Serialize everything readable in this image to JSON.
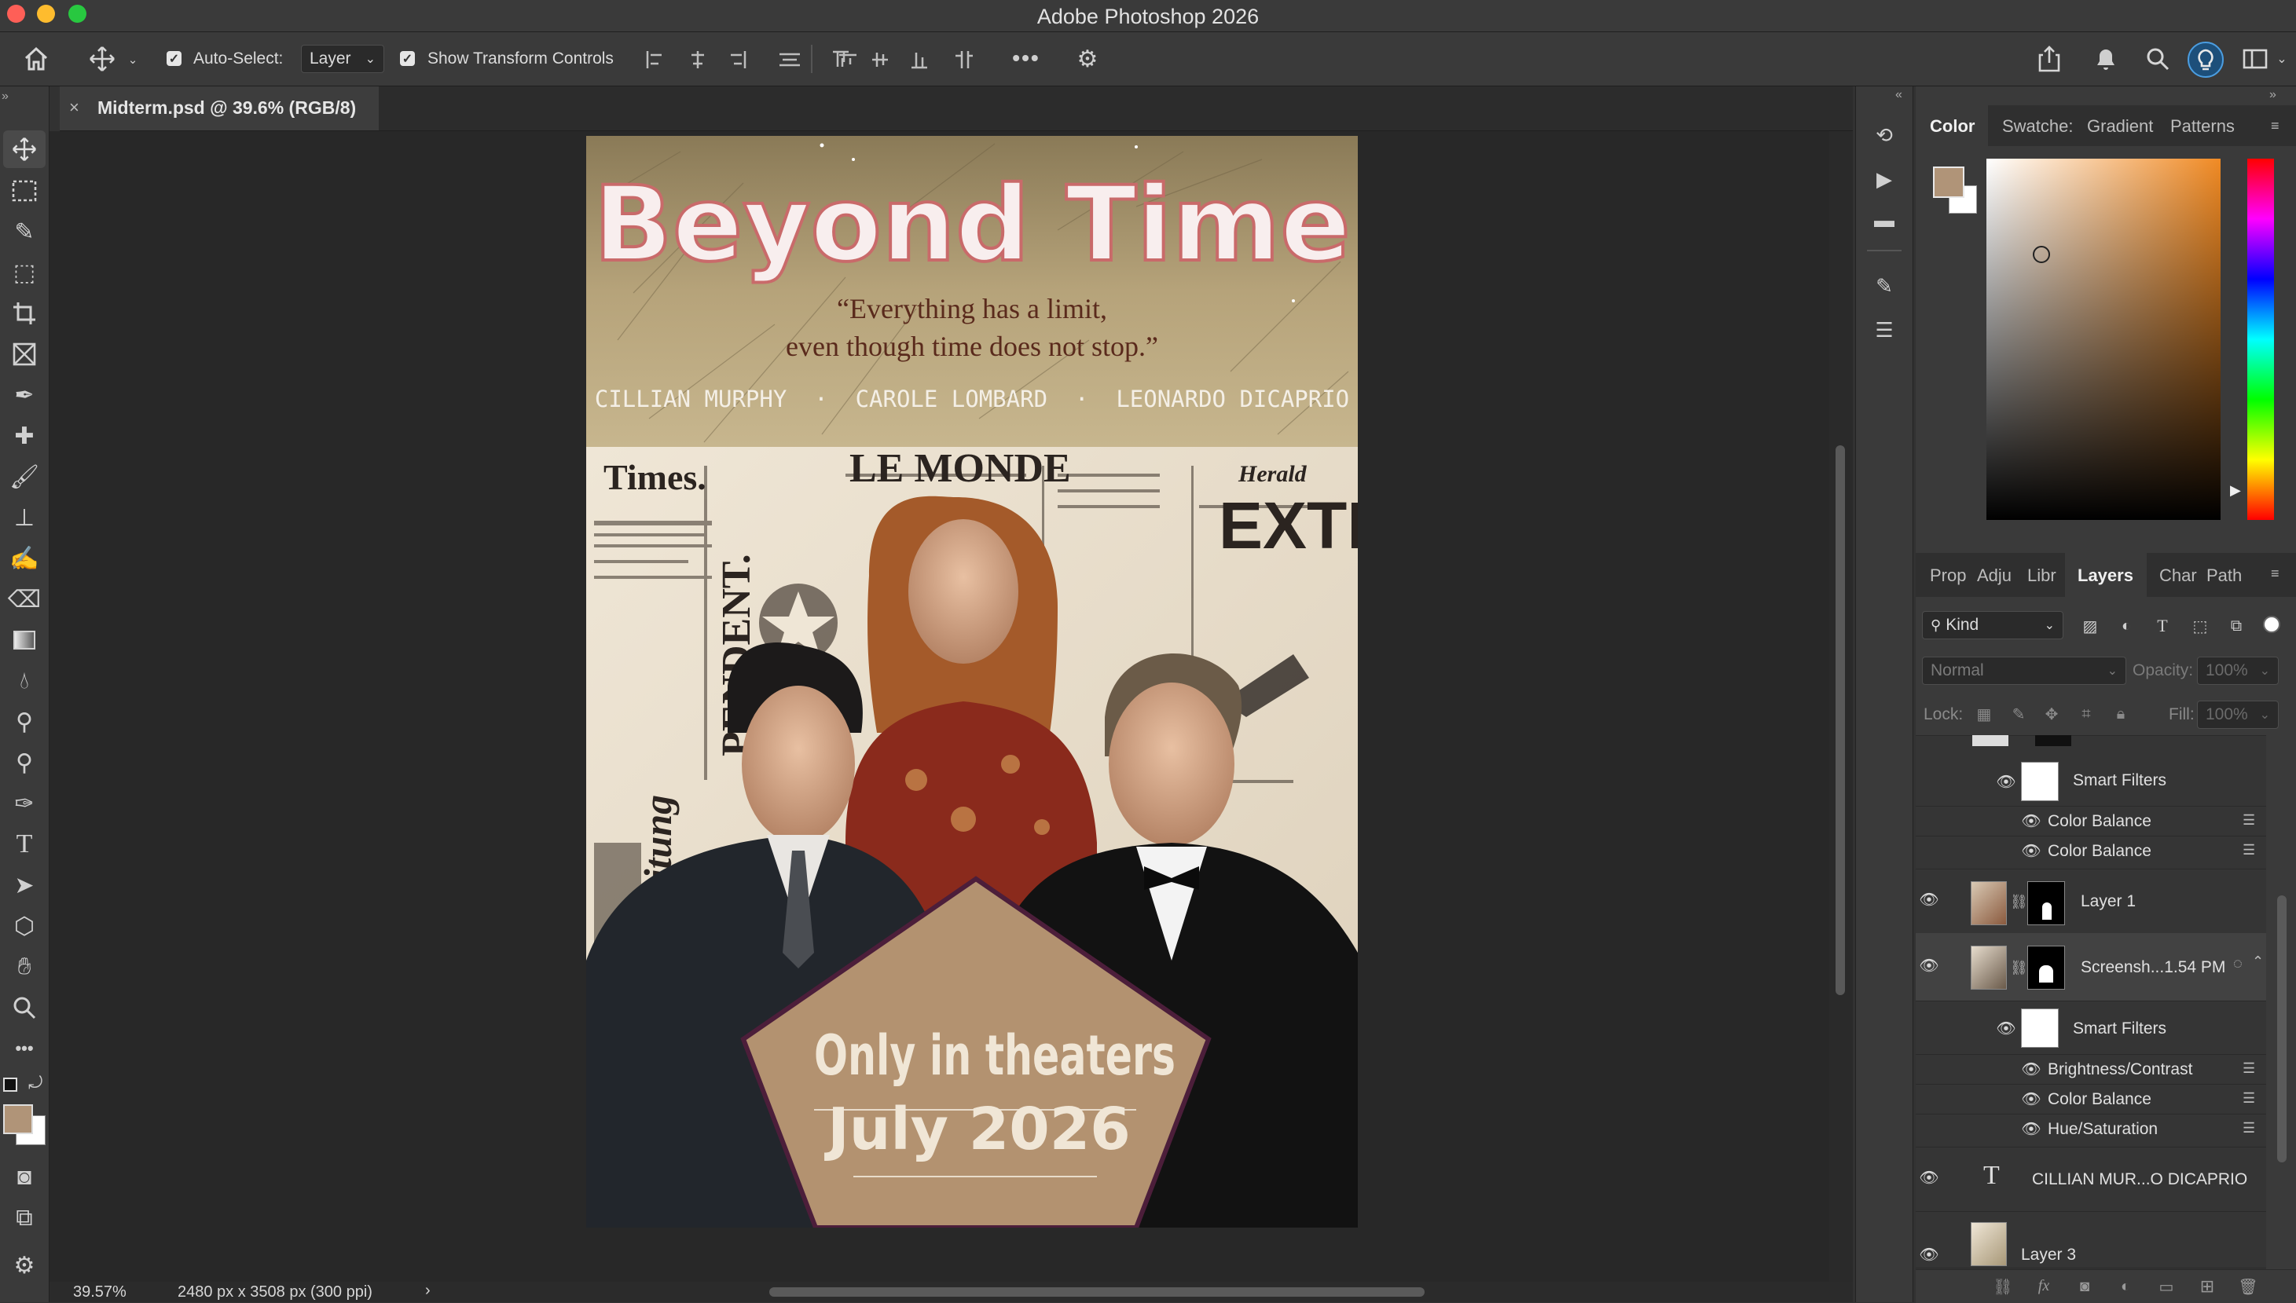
{
  "window": {
    "title": "Adobe Photoshop 2026"
  },
  "options_bar": {
    "auto_select_label": "Auto-Select:",
    "auto_select_value": "Layer",
    "show_transform_label": "Show Transform Controls",
    "more_icon": "more-icon"
  },
  "document": {
    "tab_label": "Midterm.psd @ 39.6% (RGB/8)"
  },
  "poster": {
    "title": "Beyond Time",
    "quote_line1": "“Everything has a limit,",
    "quote_line2": "even though time does not stop.”",
    "cast": "CILLIAN MURPHY  ·  CAROLE LOMBARD  ·  LEONARDO DICAPRIO",
    "newspaper_1": "Times.",
    "newspaper_2": "LE MONDE",
    "newspaper_3": "EXTR",
    "newspaper_4": "PENDENT.",
    "newspaper_5": "Zeitung",
    "newspaper_6": "Herald",
    "badge_line1": "Only in theaters",
    "badge_line2": "July 2026"
  },
  "status_bar": {
    "zoom": "39.57%",
    "doc_size": "2480 px x 3508 px (300 ppi)",
    "arrow": "›"
  },
  "color_panel": {
    "tabs": [
      "Color",
      "Swatche:",
      "Gradient",
      "Patterns"
    ],
    "foreground": "#b09478",
    "background": "#ffffff",
    "hue_color": "#f08a24"
  },
  "layers_panel": {
    "tabs": [
      "Prop",
      "Adju",
      "Libr",
      "Layers",
      "Char",
      "Path"
    ],
    "filter_kind": "Kind",
    "blend_mode": "Normal",
    "opacity_label": "Opacity:",
    "opacity_value": "100%",
    "lock_label": "Lock:",
    "fill_label": "Fill:",
    "fill_value": "100%",
    "rows": {
      "smart_filters_1": "Smart Filters",
      "color_balance_1": "Color Balance",
      "color_balance_2": "Color Balance",
      "layer1": "Layer 1",
      "screenshot": "Screensh...1.54 PM",
      "smart_filters_2": "Smart Filters",
      "brightness": "Brightness/Contrast",
      "color_balance_3": "Color Balance",
      "hue_sat": "Hue/Saturation",
      "text_layer": "CILLIAN MUR...O DICAPRIO",
      "layer3": "Layer 3"
    }
  }
}
